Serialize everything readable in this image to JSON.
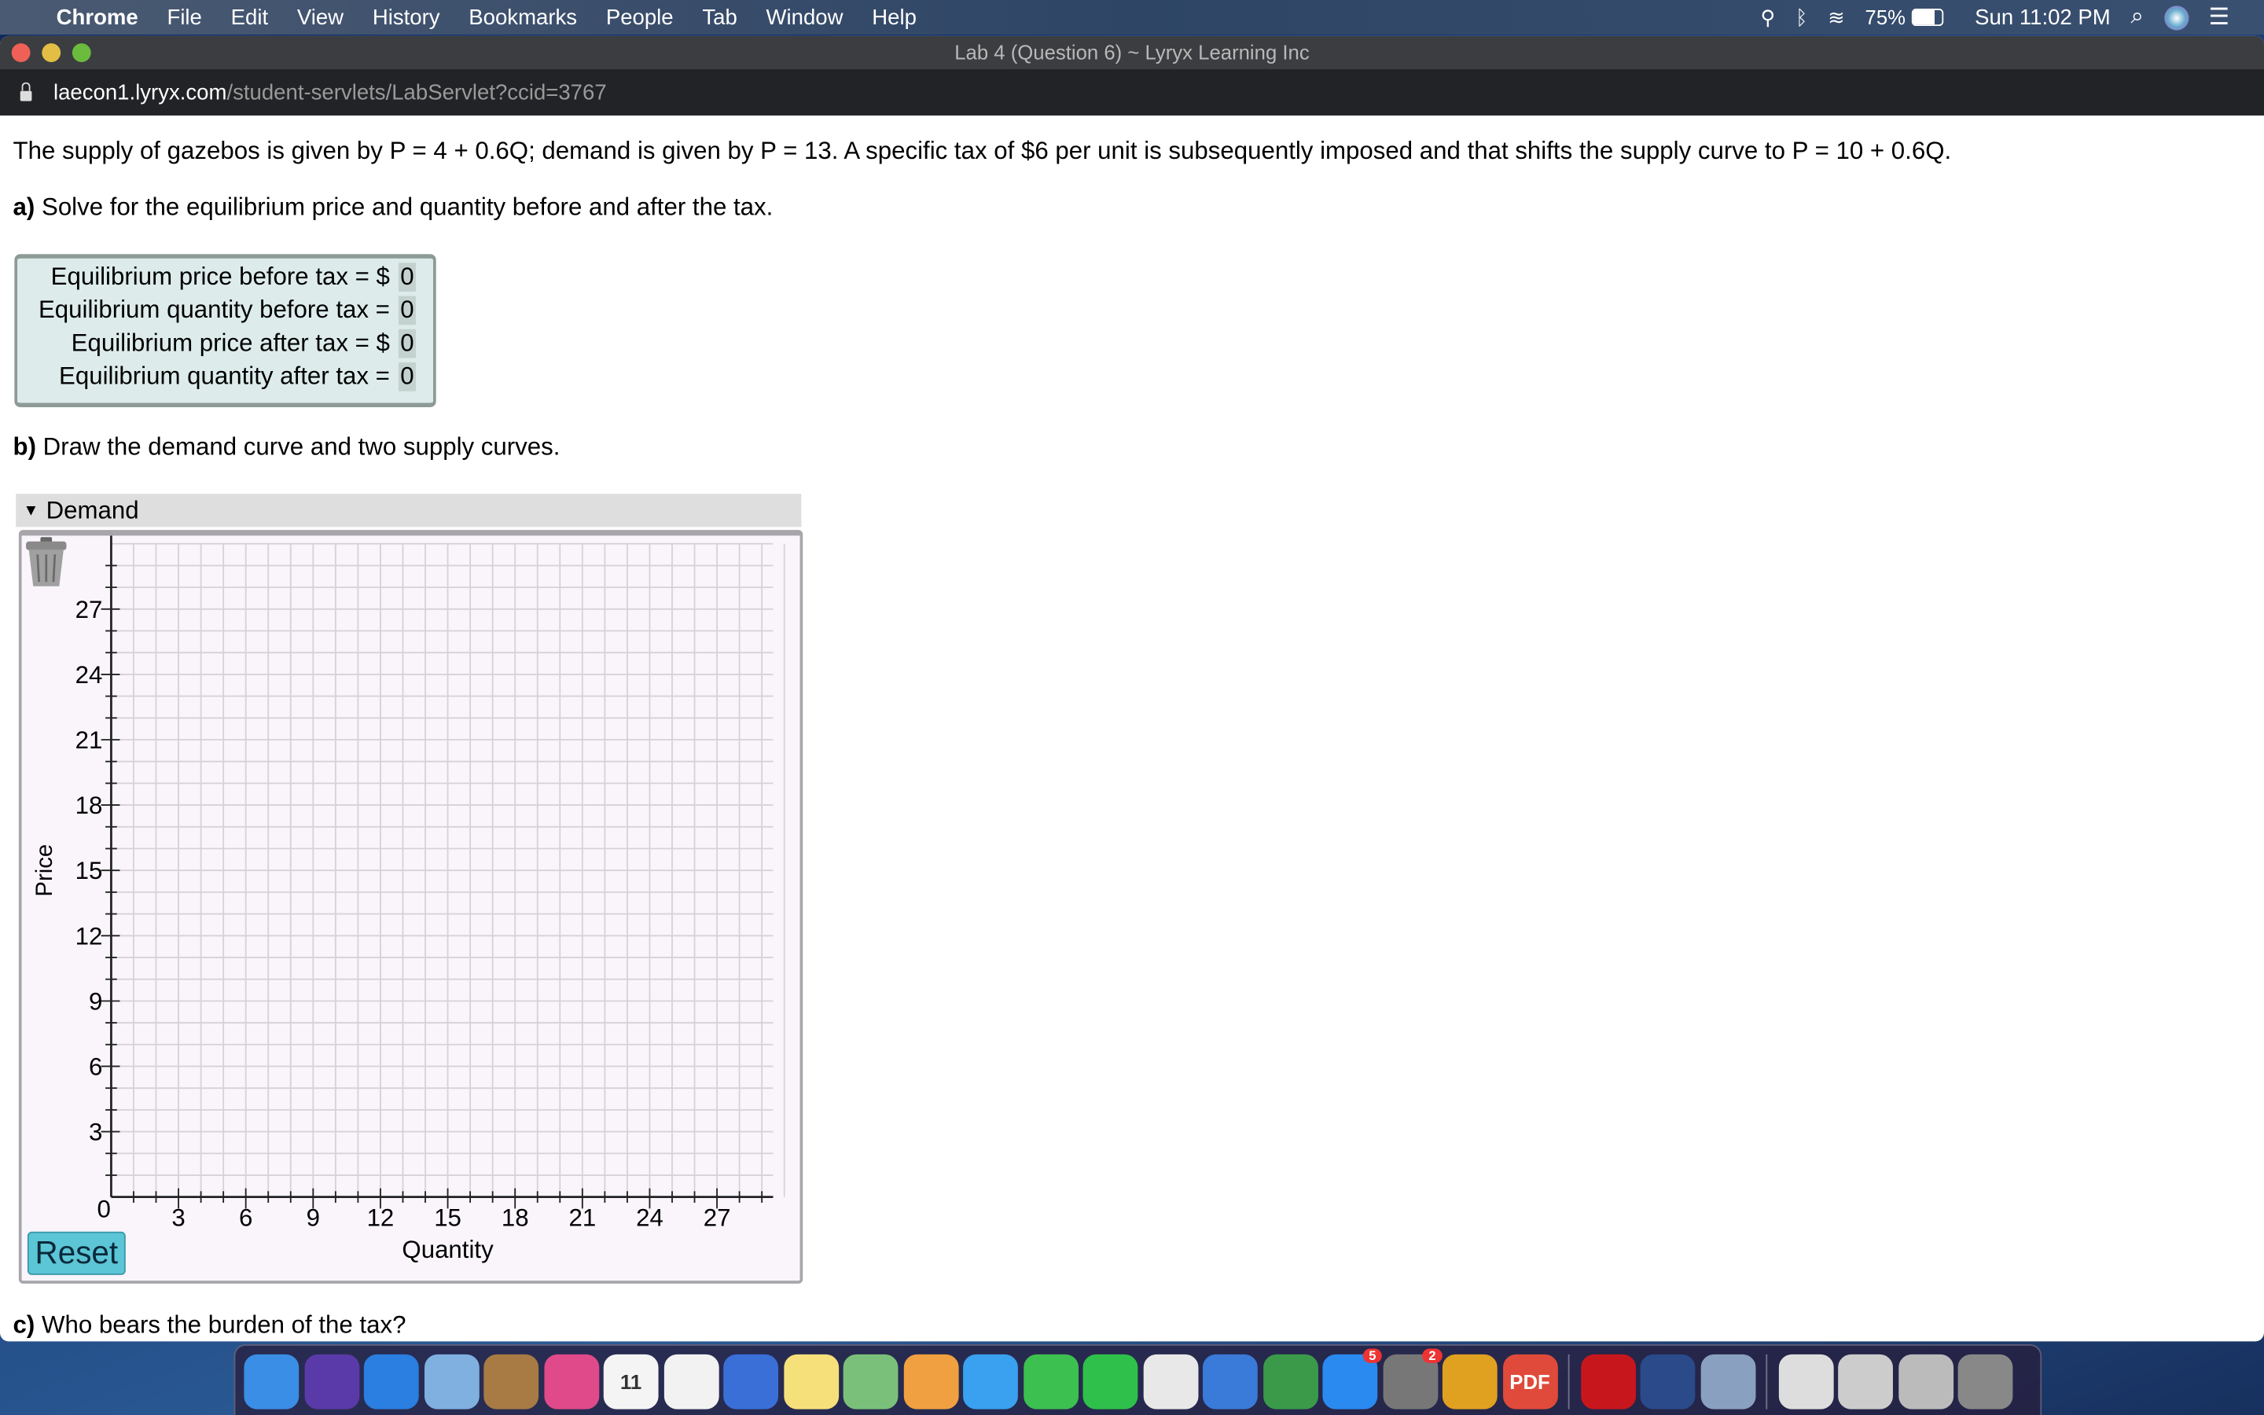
{
  "menubar": {
    "apple": "",
    "app": "Chrome",
    "items": [
      "File",
      "Edit",
      "View",
      "History",
      "Bookmarks",
      "People",
      "Tab",
      "Window",
      "Help"
    ],
    "battery": "75%",
    "clock": "Sun 11:02 PM",
    "icons": [
      "spotlight-loupe-icon",
      "bluetooth-icon",
      "wifi-icon",
      "battery-icon",
      "search-icon",
      "siri-icon",
      "control-center-icon"
    ]
  },
  "window": {
    "title": "Lab 4 (Question 6) ~ Lyryx Learning Inc",
    "url_host": "laecon1.lyryx.com",
    "url_path": "/student-servlets/LabServlet?ccid=3767"
  },
  "question": {
    "intro": "The supply of gazebos is given by P = 4 + 0.6Q; demand is given by P = 13. A specific tax of $6 per unit is subsequently imposed and that shifts the supply curve to P = 10 + 0.6Q.",
    "a_label": "a)",
    "a_text": " Solve for the equilibrium price and quantity before and after the tax.",
    "fields": [
      {
        "label": "Equilibrium price before tax = $",
        "value": "0"
      },
      {
        "label": "Equilibrium quantity before tax =",
        "value": "0"
      },
      {
        "label": "Equilibrium price after tax = $",
        "value": "0"
      },
      {
        "label": "Equilibrium quantity after tax =",
        "value": "0"
      }
    ],
    "b_label": "b)",
    "b_text": " Draw the demand curve and two supply curves.",
    "c_label": "c)",
    "c_text": " Who bears the burden of the tax?"
  },
  "graph": {
    "panel_title": "Demand",
    "reset_label": "Reset"
  },
  "chart_data": {
    "type": "line",
    "xlabel": "Quantity",
    "ylabel": "Price",
    "xlim": [
      0,
      30
    ],
    "ylim": [
      0,
      30
    ],
    "xticks": [
      "0",
      "3",
      "6",
      "9",
      "12",
      "15",
      "18",
      "21",
      "24",
      "27"
    ],
    "yticks": [
      "3",
      "6",
      "9",
      "12",
      "15",
      "18",
      "21",
      "24",
      "27"
    ],
    "grid": true,
    "series": []
  },
  "dock": {
    "apps": [
      {
        "name": "finder",
        "color": "#3a8ee6"
      },
      {
        "name": "siri",
        "color": "#5a3aa8"
      },
      {
        "name": "safari",
        "color": "#2a7fe0"
      },
      {
        "name": "mail",
        "color": "#7fb0e0"
      },
      {
        "name": "contacts",
        "color": "#a87a44"
      },
      {
        "name": "itunes",
        "color": "#e04a8a"
      },
      {
        "name": "calendar",
        "color": "#f4f4f4",
        "label": "11"
      },
      {
        "name": "reminders",
        "color": "#f2f2f2"
      },
      {
        "name": "google-docs",
        "color": "#3a6fd8"
      },
      {
        "name": "notes",
        "color": "#f6e07a"
      },
      {
        "name": "maps",
        "color": "#7ac07a"
      },
      {
        "name": "photos",
        "color": "#f0a040"
      },
      {
        "name": "messages",
        "color": "#3aa0f0"
      },
      {
        "name": "facetime",
        "color": "#3cc050"
      },
      {
        "name": "whatsapp",
        "color": "#2ec04a"
      },
      {
        "name": "textedit",
        "color": "#e8e8e8"
      },
      {
        "name": "keynote",
        "color": "#3a7ad8"
      },
      {
        "name": "numbers",
        "color": "#3a9a4a"
      },
      {
        "name": "app-store",
        "color": "#2a8af0",
        "badge": "5"
      },
      {
        "name": "system-preferences",
        "color": "#777",
        "badge": "2"
      },
      {
        "name": "chrome",
        "color": "#e0a020"
      },
      {
        "name": "pdf-expert",
        "color": "#e04a3a",
        "label": "PDF"
      },
      {
        "name": "acrobat",
        "color": "#c8161d"
      },
      {
        "name": "quicktime",
        "color": "#2a4a8a"
      },
      {
        "name": "preview",
        "color": "#8aa0c0"
      },
      {
        "name": "document-1",
        "color": "#ddd"
      },
      {
        "name": "document-2",
        "color": "#ccc"
      },
      {
        "name": "document-3",
        "color": "#bbb"
      },
      {
        "name": "trash",
        "color": "#888"
      }
    ]
  }
}
